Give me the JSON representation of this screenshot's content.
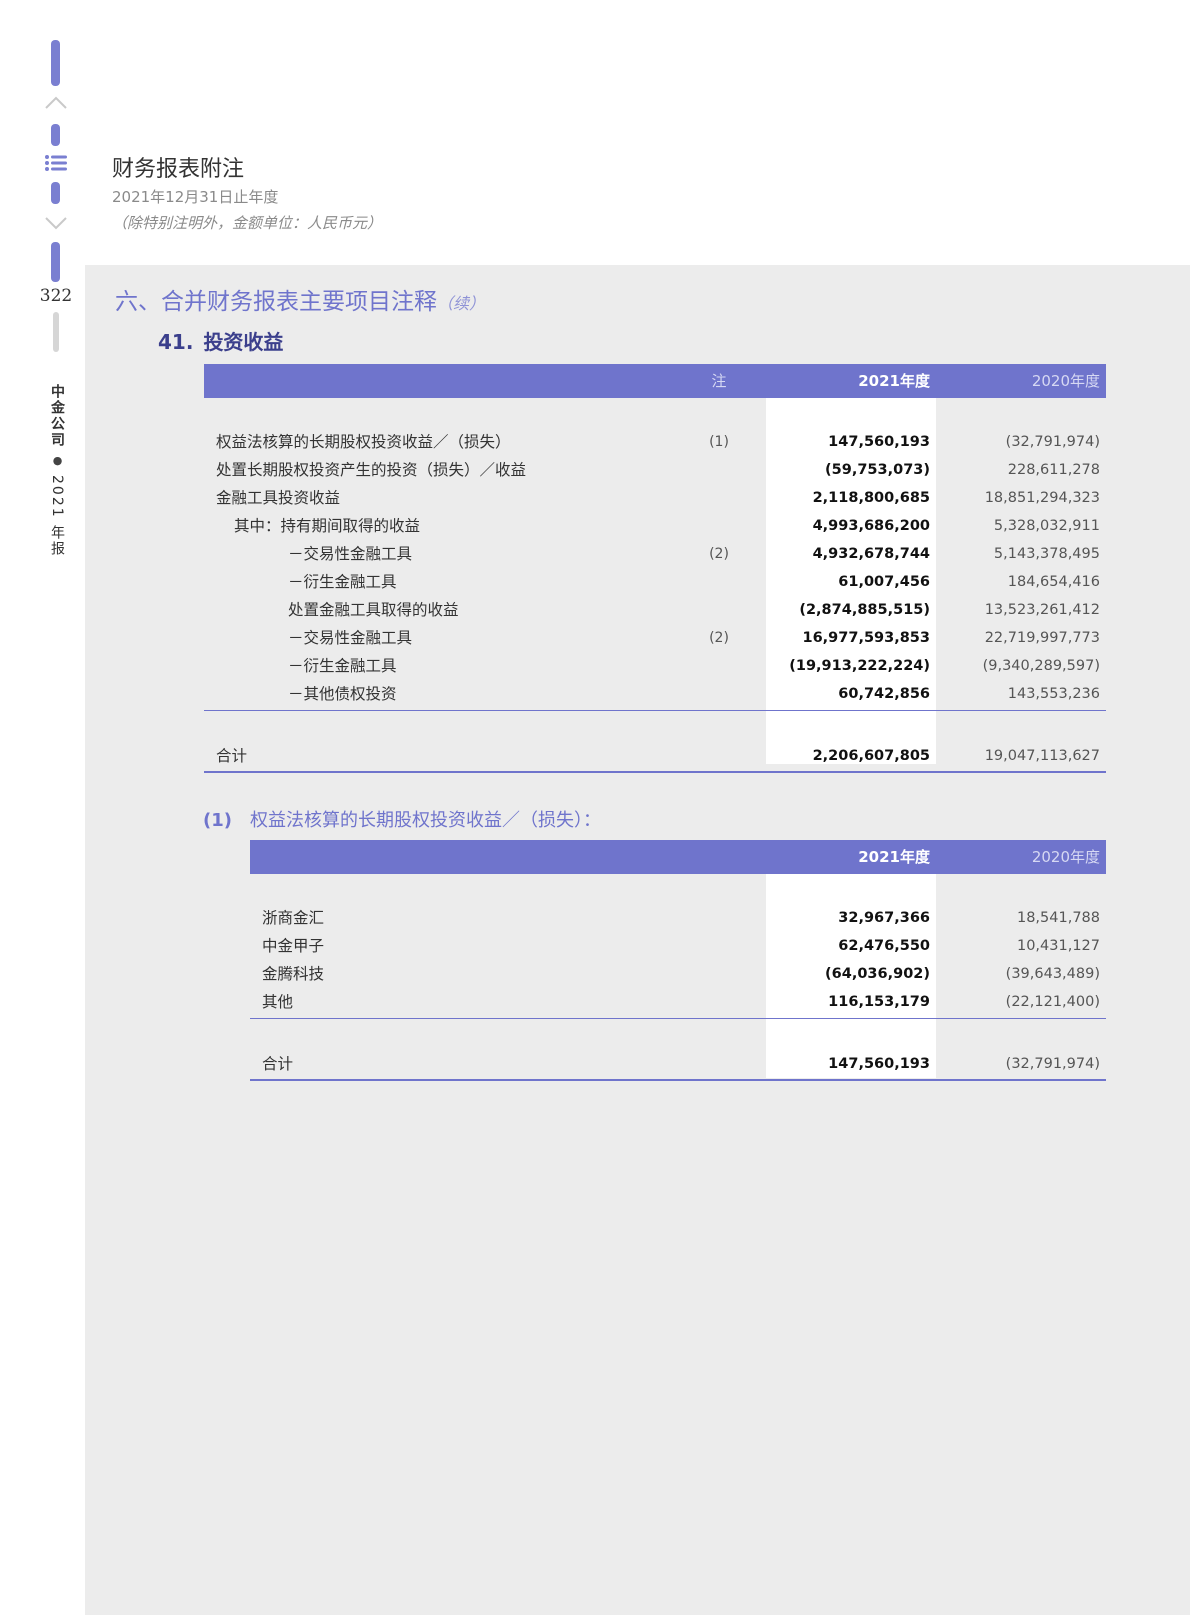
{
  "header": {
    "title": "财务报表附注",
    "period": "2021年12月31日止年度",
    "unit_note": "（除特别注明外，金额单位：人民币元）"
  },
  "sidebar": {
    "page_number": "322",
    "company": "中金公司",
    "report": "2021 年报",
    "icons": [
      "chevron-up-icon",
      "list-icon",
      "chevron-down-icon"
    ]
  },
  "section": {
    "title": "六、合并财务报表主要项目注释",
    "continued": "（续）",
    "sub_number": "41.",
    "sub_title": "投资收益"
  },
  "table1": {
    "headers": {
      "label": "",
      "note": "注",
      "y2021": "2021年度",
      "y2020": "2020年度"
    },
    "rows": [
      {
        "label": "权益法核算的长期股权投资收益／（损失）",
        "note": "(1)",
        "y2021": "147,560,193",
        "y2020": "(32,791,974)"
      },
      {
        "label": "处置长期股权投资产生的投资（损失）／收益",
        "note": "",
        "y2021": "(59,753,073)",
        "y2020": "228,611,278"
      },
      {
        "label": "金融工具投资收益",
        "note": "",
        "y2021": "2,118,800,685",
        "y2020": "18,851,294,323"
      },
      {
        "label": "其中：持有期间取得的收益",
        "note": "",
        "y2021": "4,993,686,200",
        "y2020": "5,328,032,911"
      },
      {
        "label": "－交易性金融工具",
        "note": "(2)",
        "y2021": "4,932,678,744",
        "y2020": "5,143,378,495"
      },
      {
        "label": "－衍生金融工具",
        "note": "",
        "y2021": "61,007,456",
        "y2020": "184,654,416"
      },
      {
        "label": "处置金融工具取得的收益",
        "note": "",
        "y2021": "(2,874,885,515)",
        "y2020": "13,523,261,412"
      },
      {
        "label": "－交易性金融工具",
        "note": "(2)",
        "y2021": "16,977,593,853",
        "y2020": "22,719,997,773"
      },
      {
        "label": "－衍生金融工具",
        "note": "",
        "y2021": "(19,913,222,224)",
        "y2020": "(9,340,289,597)"
      },
      {
        "label": "－其他债权投资",
        "note": "",
        "y2021": "60,742,856",
        "y2020": "143,553,236"
      }
    ],
    "total": {
      "label": "合计",
      "y2021": "2,206,607,805",
      "y2020": "19,047,113,627"
    }
  },
  "note1": {
    "label": "(1)",
    "title": "权益法核算的长期股权投资收益／（损失）：",
    "headers": {
      "y2021": "2021年度",
      "y2020": "2020年度"
    },
    "rows": [
      {
        "label": "浙商金汇",
        "y2021": "32,967,366",
        "y2020": "18,541,788"
      },
      {
        "label": "中金甲子",
        "y2021": "62,476,550",
        "y2020": "10,431,127"
      },
      {
        "label": "金腾科技",
        "y2021": "(64,036,902)",
        "y2020": "(39,643,489)"
      },
      {
        "label": "其他",
        "y2021": "116,153,179",
        "y2020": "(22,121,400)"
      }
    ],
    "total": {
      "label": "合计",
      "y2021": "147,560,193",
      "y2020": "(32,791,974)"
    }
  },
  "colors": {
    "accent": "#6f74cc",
    "page_bg": "#ececec",
    "title_dark": "#3b3f8c"
  }
}
